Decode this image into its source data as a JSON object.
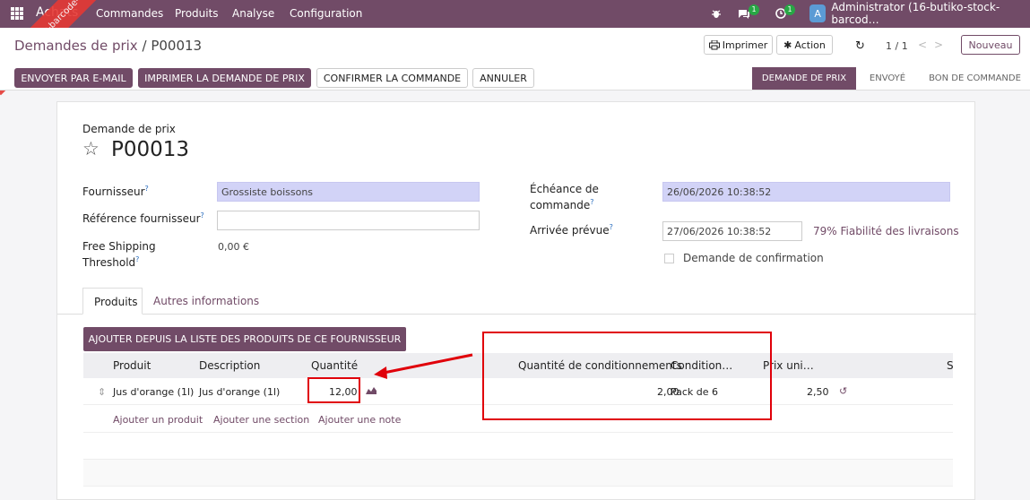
{
  "ribbon": {
    "text": "TEST ko-stock-barcode-fr-be"
  },
  "navbar": {
    "brand": "Achats",
    "menu": [
      "Commandes",
      "Produits",
      "Analyse",
      "Configuration"
    ],
    "chat_badge": "1",
    "activity_badge": "1",
    "avatar_letter": "A",
    "user": "Administrator (16-butiko-stock-barcod…"
  },
  "controls": {
    "breadcrumb_parent": "Demandes de prix",
    "breadcrumb_sep": "/",
    "breadcrumb_current": "P00013",
    "print_label": "Imprimer",
    "action_label": "Action",
    "pager": "1 / 1",
    "new_label": "Nouveau",
    "buttons": [
      "ENVOYER PAR E-MAIL",
      "IMPRIMER LA DEMANDE DE PRIX",
      "CONFIRMER LA COMMANDE",
      "ANNULER"
    ],
    "statuses": [
      "DEMANDE DE PRIX",
      "ENVOYÉ",
      "BON DE COMMANDE"
    ]
  },
  "form": {
    "subtitle": "Demande de prix",
    "name": "P00013",
    "supplier_label": "Fournisseur",
    "supplier_value": "Grossiste boissons",
    "ref_label": "Référence fournisseur",
    "ref_value": "",
    "shipping_label_1": "Free Shipping",
    "shipping_label_2": "Threshold",
    "shipping_value": "0,00 €",
    "deadline_label_1": "Échéance de",
    "deadline_label_2": "commande",
    "deadline_value": "26/06/2026 10:38:52",
    "arrival_label": "Arrivée prévue",
    "arrival_value": "27/06/2026 10:38:52",
    "reliability": "79% Fiabilité des livraisons",
    "confirm_label": "Demande de confirmation",
    "help_mark": "?"
  },
  "tabs": [
    "Produits",
    "Autres informations"
  ],
  "lines": {
    "add_from_supplier": "AJOUTER DEPUIS LA LISTE DES PRODUITS DE CE FOURNISSEUR",
    "columns": [
      "Produit",
      "Description",
      "Quantité",
      "Quantité de conditionnements",
      "Condition…",
      "Prix uni…",
      "S"
    ],
    "rows": [
      {
        "product": "Jus d'orange (1l)",
        "description": "Jus d'orange (1l)",
        "qty": "12,00",
        "pkg_qty": "2,00",
        "packaging": "Pack de 6",
        "price": "2,50"
      }
    ],
    "add_product": "Ajouter un produit",
    "add_section": "Ajouter une section",
    "add_note": "Ajouter une note"
  },
  "colors": {
    "primary": "#714b67",
    "annotation": "#e0000a",
    "required_field": "#d2d3f7"
  }
}
